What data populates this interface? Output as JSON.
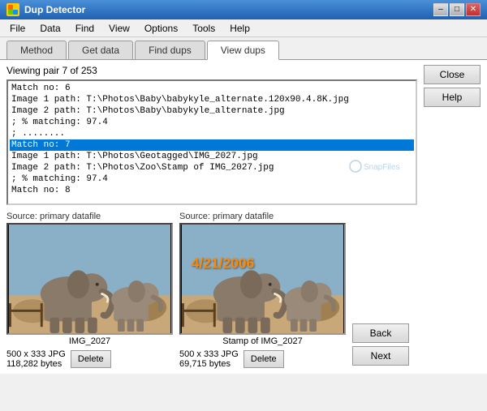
{
  "title_bar": {
    "icon": "DD",
    "title": "Dup Detector",
    "minimize_label": "–",
    "maximize_label": "□",
    "close_label": "✕"
  },
  "menu": {
    "items": [
      "File",
      "Data",
      "Find",
      "View",
      "Options",
      "Tools",
      "Help"
    ]
  },
  "tabs": {
    "items": [
      "Method",
      "Get data",
      "Find dups",
      "View dups"
    ],
    "active": 3
  },
  "right_buttons": {
    "close_label": "Close",
    "help_label": "Help"
  },
  "viewing": {
    "label": "Viewing pair 7 of 253"
  },
  "list_items": [
    {
      "text": "Match no: 6",
      "selected": false
    },
    {
      "text": "Image 1 path: T:\\Photos\\Baby\\babykyle_alternate.120x90.4.8K.jpg",
      "selected": false
    },
    {
      "text": "Image 2 path: T:\\Photos\\Baby\\babykyle_alternate.jpg",
      "selected": false
    },
    {
      "text": "; % matching: 97.4",
      "selected": false
    },
    {
      "text": "; ........",
      "selected": false
    },
    {
      "text": "Match no: 7",
      "selected": true
    },
    {
      "text": "Image 1 path: T:\\Photos\\Geotagged\\IMG_2027.jpg",
      "selected": false
    },
    {
      "text": "Image 2 path: T:\\Photos\\Zoo\\Stamp of IMG_2027.jpg",
      "selected": false
    },
    {
      "text": "; % matching: 97.4",
      "selected": false
    },
    {
      "text": "Match no: 8",
      "selected": false
    }
  ],
  "image1": {
    "source_label": "Source: primary datafile",
    "caption": "IMG_2027",
    "info_line1": "500 x 333 JPG",
    "info_line2": "118,282 bytes",
    "delete_label": "Delete"
  },
  "image2": {
    "source_label": "Source: primary datafile",
    "caption": "Stamp of IMG_2027",
    "stamp_text": "4/21/2006",
    "info_line1": "500 x 333 JPG",
    "info_line2": "69,715 bytes",
    "delete_label": "Delete"
  },
  "nav_buttons": {
    "back_label": "Back",
    "next_label": "Next"
  },
  "watermark": "SnapFiles"
}
